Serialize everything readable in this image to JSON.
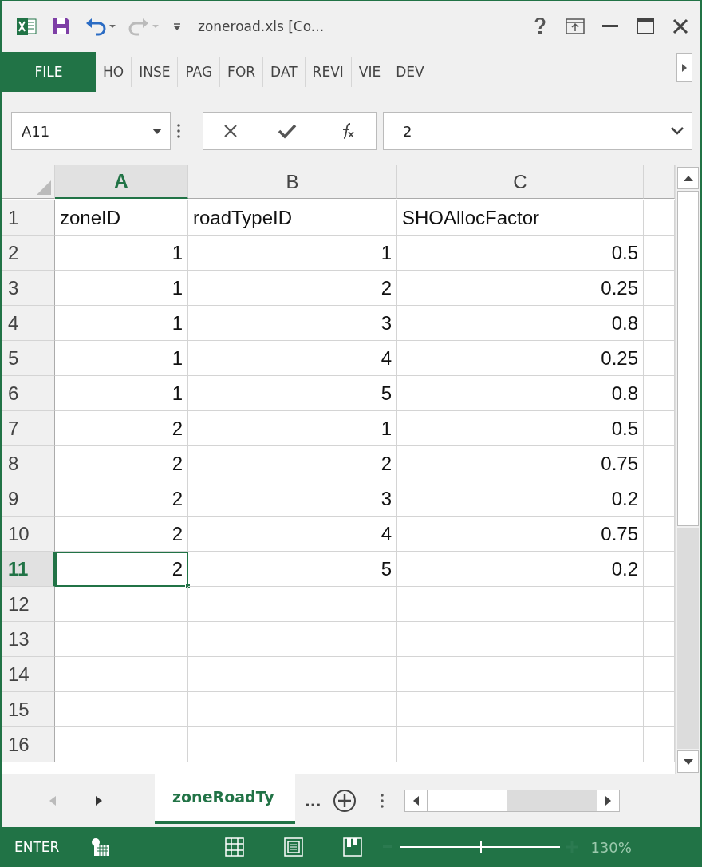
{
  "title_bar": {
    "title": "zoneroad.xls  [Co..."
  },
  "ribbon": {
    "file_tab": "FILE",
    "tabs": [
      {
        "label": "HO",
        "selected": false
      },
      {
        "label": "INSE",
        "selected": false
      },
      {
        "label": "PAG",
        "selected": false
      },
      {
        "label": "FOR",
        "selected": false
      },
      {
        "label": "DAT",
        "selected": false
      },
      {
        "label": "REVI",
        "selected": false
      },
      {
        "label": "VIE",
        "selected": false
      },
      {
        "label": "DEV",
        "selected": false
      }
    ]
  },
  "formula_bar": {
    "name_box": "A11",
    "value": "2"
  },
  "sheet": {
    "columns": [
      {
        "label": "A",
        "selected": true
      },
      {
        "label": "B",
        "selected": false
      },
      {
        "label": "C",
        "selected": false
      }
    ],
    "rows": [
      {
        "number": "1",
        "selected": false,
        "cells": [
          "zoneID",
          "roadTypeID",
          "SHOAllocFactor"
        ],
        "kind": "header"
      },
      {
        "number": "2",
        "selected": false,
        "cells": [
          "1",
          "1",
          "0.5"
        ],
        "kind": "number"
      },
      {
        "number": "3",
        "selected": false,
        "cells": [
          "1",
          "2",
          "0.25"
        ],
        "kind": "number"
      },
      {
        "number": "4",
        "selected": false,
        "cells": [
          "1",
          "3",
          "0.8"
        ],
        "kind": "number"
      },
      {
        "number": "5",
        "selected": false,
        "cells": [
          "1",
          "4",
          "0.25"
        ],
        "kind": "number"
      },
      {
        "number": "6",
        "selected": false,
        "cells": [
          "1",
          "5",
          "0.8"
        ],
        "kind": "number"
      },
      {
        "number": "7",
        "selected": false,
        "cells": [
          "2",
          "1",
          "0.5"
        ],
        "kind": "number"
      },
      {
        "number": "8",
        "selected": false,
        "cells": [
          "2",
          "2",
          "0.75"
        ],
        "kind": "number"
      },
      {
        "number": "9",
        "selected": false,
        "cells": [
          "2",
          "3",
          "0.2"
        ],
        "kind": "number"
      },
      {
        "number": "10",
        "selected": false,
        "cells": [
          "2",
          "4",
          "0.75"
        ],
        "kind": "number"
      },
      {
        "number": "11",
        "selected": true,
        "cells": [
          "2",
          "5",
          "0.2"
        ],
        "kind": "number"
      },
      {
        "number": "12",
        "selected": false,
        "cells": [],
        "kind": "number"
      },
      {
        "number": "13",
        "selected": false,
        "cells": [],
        "kind": "number"
      },
      {
        "number": "14",
        "selected": false,
        "cells": [],
        "kind": "number"
      },
      {
        "number": "15",
        "selected": false,
        "cells": [],
        "kind": "number"
      },
      {
        "number": "16",
        "selected": false,
        "cells": [],
        "kind": "number"
      }
    ]
  },
  "sheet_tabs": {
    "tabs": [
      {
        "label": "zoneRoadTy",
        "selected": true
      }
    ],
    "more": "..."
  },
  "status_bar": {
    "mode": "ENTER",
    "zoom": "130%",
    "zoom_slider": {
      "level": 0.5
    }
  }
}
